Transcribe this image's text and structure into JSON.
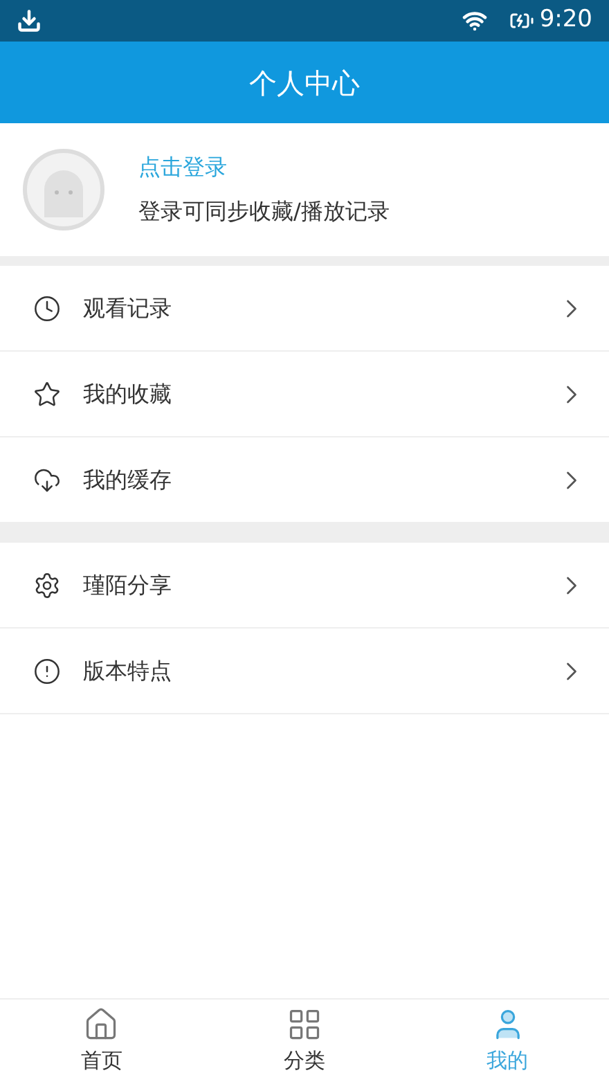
{
  "status_bar": {
    "time": "9:20"
  },
  "header": {
    "title": "个人中心"
  },
  "profile": {
    "login": "点击登录",
    "hint": "登录可同步收藏/播放记录"
  },
  "menu_groups": [
    [
      {
        "kind": "history",
        "label": "观看记录"
      },
      {
        "kind": "favorite",
        "label": "我的收藏"
      },
      {
        "kind": "cache",
        "label": "我的缓存"
      }
    ],
    [
      {
        "kind": "share",
        "label": "瑾陌分享"
      },
      {
        "kind": "about",
        "label": "版本特点"
      }
    ]
  ],
  "tabs": [
    {
      "kind": "home",
      "label": "首页",
      "selected": false
    },
    {
      "kind": "category",
      "label": "分类",
      "selected": false
    },
    {
      "kind": "me",
      "label": "我的",
      "selected": true
    }
  ]
}
